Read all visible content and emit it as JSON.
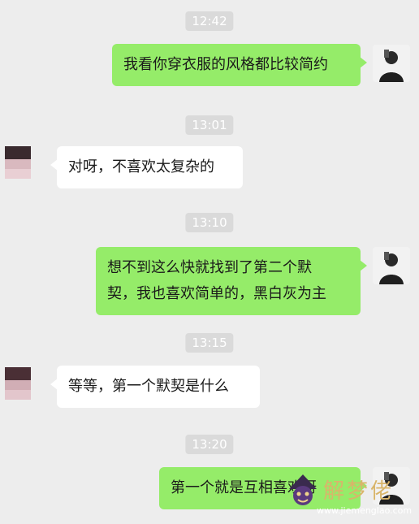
{
  "messages": [
    {
      "time": "12:42",
      "direction": "out",
      "text": "我看你穿衣服的风格都比较简约"
    },
    {
      "time": "13:01",
      "direction": "in",
      "text": "对呀，不喜欢太复杂的"
    },
    {
      "time": "13:10",
      "direction": "out",
      "text_line1": "想不到这么快就找到了第二个默",
      "text_line2": "契，我也喜欢简单的，黑白灰为主"
    },
    {
      "time": "13:15",
      "direction": "in",
      "text": "等等，第一个默契是什么"
    },
    {
      "time": "13:20",
      "direction": "out",
      "text": "第一个就是互相喜欢呀"
    }
  ],
  "watermark": {
    "text": "解梦佬",
    "url": "www.jiemenglao.com"
  },
  "colors": {
    "background": "#ededed",
    "outgoing_bubble": "#95ec69",
    "incoming_bubble": "#ffffff",
    "timestamp_bg": "#dadada"
  }
}
